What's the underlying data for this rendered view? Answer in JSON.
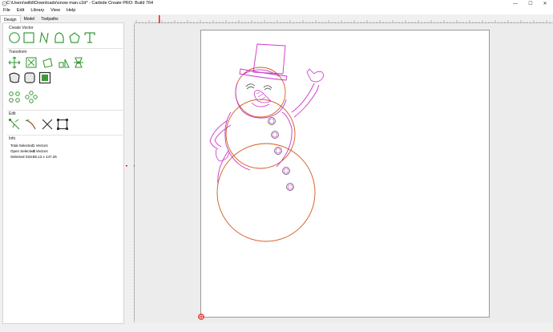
{
  "window": {
    "title": "C:\\Users\\willd\\Downloads\\snow man.c2d* - Carbide Create PRO: Build 764",
    "minimize_icon": "minimize-icon",
    "maximize_icon": "maximize-icon",
    "close_icon": "close-icon"
  },
  "menu": [
    {
      "label": "File"
    },
    {
      "label": "Edit"
    },
    {
      "label": "Library"
    },
    {
      "label": "View"
    },
    {
      "label": "Help"
    }
  ],
  "tabs": [
    {
      "label": "Design",
      "active": true
    },
    {
      "label": "Model",
      "active": false
    },
    {
      "label": "Toolpaths",
      "active": false
    }
  ],
  "sections": {
    "create_vector": "Create Vector",
    "transform": "Transform",
    "edit": "Edit",
    "info": "Info"
  },
  "info": {
    "total_selected_label": "Total Selected:",
    "total_selected_value": "1 Vectors",
    "open_selected_label": "Open Selected:",
    "open_selected_value": "0 Vectors",
    "selected_size_label": "Selected Size:",
    "selected_size_value": "85.13 x 147.26"
  },
  "colors": {
    "accent_green": "#3a9a3a",
    "snowman_orange": "#d25a1e",
    "snowman_magenta": "#cc33cc",
    "origin_marker": "#e02020"
  }
}
